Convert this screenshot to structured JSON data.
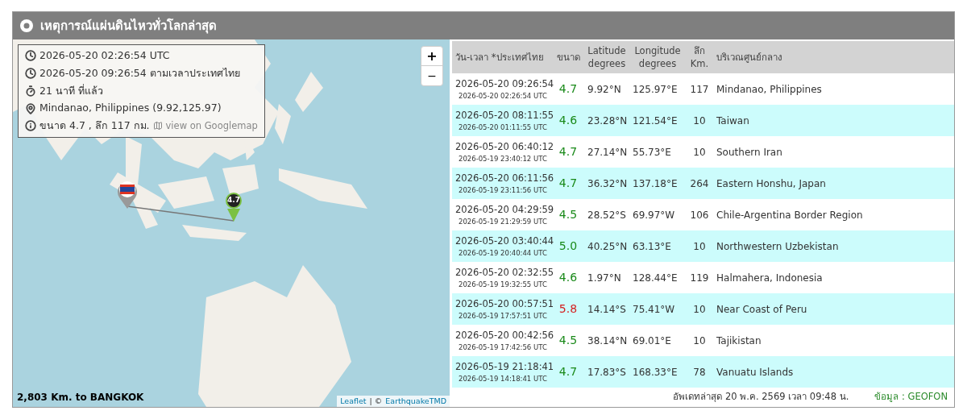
{
  "header": {
    "title": "เหตุการณ์แผ่นดินไหวทั่วโลกล่าสุด"
  },
  "map": {
    "zoom_in": "+",
    "zoom_out": "−",
    "info": [
      {
        "kind": "clock",
        "text": "2026-05-20 02:26:54 UTC"
      },
      {
        "kind": "clock",
        "text": "2026-05-20 09:26:54 ตามเวลาประเทศไทย"
      },
      {
        "kind": "timer",
        "text": "21 นาที ที่แล้ว"
      },
      {
        "kind": "pin",
        "text": "Mindanao, Philippines (9.92,125.97)"
      },
      {
        "kind": "info",
        "text": "ขนาด 4.7 , ลึก 117 กม.",
        "link": "view on Googlemap"
      }
    ],
    "marker_label": "4.7",
    "distance": "2,803 Km. to BANGKOK",
    "attribution": {
      "leaflet": "Leaflet",
      "sep": "| ©",
      "owner": "EarthquakeTMD"
    }
  },
  "table": {
    "columns": [
      "วัน-เวลา *ประเทศไทย",
      "ขนาด",
      "Latitude degrees",
      "Longitude degrees",
      "ลึก Km.",
      "บริเวณศูนย์กลาง"
    ],
    "rows": [
      {
        "local": "2026-05-20 09:26:54",
        "utc": "2026-05-20 02:26:54 UTC",
        "mag": "4.7",
        "color": "#1a8a1a",
        "lat": "9.92°N",
        "lon": "125.97°E",
        "depth": "117",
        "region": "Mindanao, Philippines"
      },
      {
        "local": "2026-05-20 08:11:55",
        "utc": "2026-05-20 01:11:55 UTC",
        "mag": "4.6",
        "color": "#1a8a1a",
        "lat": "23.28°N",
        "lon": "121.54°E",
        "depth": "10",
        "region": "Taiwan"
      },
      {
        "local": "2026-05-20 06:40:12",
        "utc": "2026-05-19 23:40:12 UTC",
        "mag": "4.7",
        "color": "#1a8a1a",
        "lat": "27.14°N",
        "lon": "55.73°E",
        "depth": "10",
        "region": "Southern Iran"
      },
      {
        "local": "2026-05-20 06:11:56",
        "utc": "2026-05-19 23:11:56 UTC",
        "mag": "4.7",
        "color": "#1a8a1a",
        "lat": "36.32°N",
        "lon": "137.18°E",
        "depth": "264",
        "region": "Eastern Honshu, Japan"
      },
      {
        "local": "2026-05-20 04:29:59",
        "utc": "2026-05-19 21:29:59 UTC",
        "mag": "4.5",
        "color": "#1a8a1a",
        "lat": "28.52°S",
        "lon": "69.97°W",
        "depth": "106",
        "region": "Chile-Argentina Border Region"
      },
      {
        "local": "2026-05-20 03:40:44",
        "utc": "2026-05-19 20:40:44 UTC",
        "mag": "5.0",
        "color": "#1a8a1a",
        "lat": "40.25°N",
        "lon": "63.13°E",
        "depth": "10",
        "region": "Northwestern Uzbekistan"
      },
      {
        "local": "2026-05-20 02:32:55",
        "utc": "2026-05-19 19:32:55 UTC",
        "mag": "4.6",
        "color": "#1a8a1a",
        "lat": "1.97°N",
        "lon": "128.44°E",
        "depth": "119",
        "region": "Halmahera, Indonesia"
      },
      {
        "local": "2026-05-20 00:57:51",
        "utc": "2026-05-19 17:57:51 UTC",
        "mag": "5.8",
        "color": "#d42020",
        "lat": "14.14°S",
        "lon": "75.41°W",
        "depth": "10",
        "region": "Near Coast of Peru"
      },
      {
        "local": "2026-05-20 00:42:56",
        "utc": "2026-05-19 17:42:56 UTC",
        "mag": "4.5",
        "color": "#1a8a1a",
        "lat": "38.14°N",
        "lon": "69.01°E",
        "depth": "10",
        "region": "Tajikistan"
      },
      {
        "local": "2026-05-19 21:18:41",
        "utc": "2026-05-19 14:18:41 UTC",
        "mag": "4.7",
        "color": "#1a8a1a",
        "lat": "17.83°S",
        "lon": "168.33°E",
        "depth": "78",
        "region": "Vanuatu Islands"
      }
    ],
    "updated": "อัพเดทล่าสุด 20 พ.ค. 2569 เวลา 09:48 น.",
    "source": "ข้อมูล : GEOFON"
  }
}
